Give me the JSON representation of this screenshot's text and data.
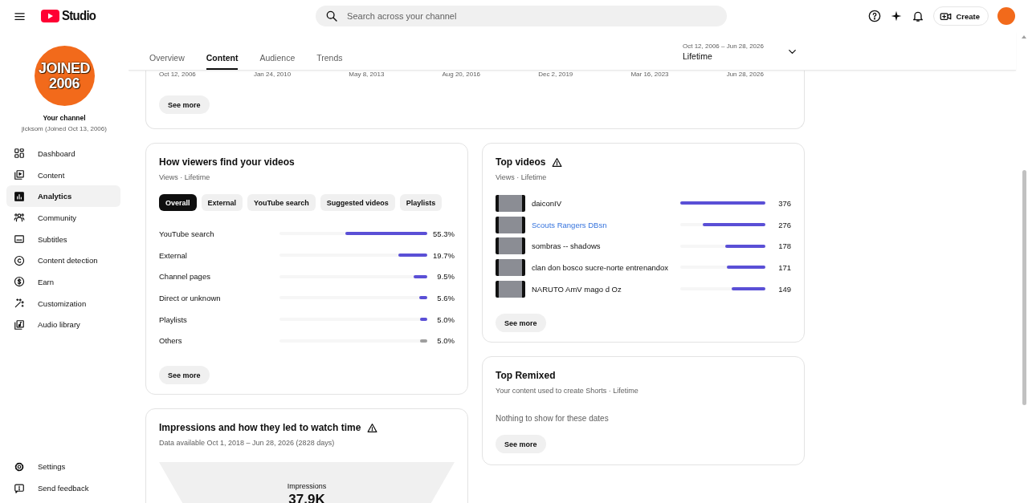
{
  "topbar": {
    "logo_text": "Studio",
    "search": {
      "placeholder": "Search across your channel"
    },
    "create_button": "Create"
  },
  "channel": {
    "avatar_text": [
      "JOINED",
      "2006"
    ],
    "title": "Your channel",
    "subtitle": "jicksom (Joined Oct 13, 2006)"
  },
  "sidebar": {
    "items": [
      {
        "label": "Dashboard",
        "selected": false
      },
      {
        "label": "Content",
        "selected": false
      },
      {
        "label": "Analytics",
        "selected": true
      },
      {
        "label": "Community",
        "selected": false
      },
      {
        "label": "Subtitles",
        "selected": false
      },
      {
        "label": "Content detection",
        "selected": false
      },
      {
        "label": "Earn",
        "selected": false
      },
      {
        "label": "Customization",
        "selected": false
      },
      {
        "label": "Audio library",
        "selected": false
      }
    ],
    "footer_items": [
      {
        "label": "Settings"
      },
      {
        "label": "Send feedback"
      }
    ]
  },
  "tabs": [
    {
      "label": "Overview",
      "selected": false
    },
    {
      "label": "Content",
      "selected": true
    },
    {
      "label": "Audience",
      "selected": false
    },
    {
      "label": "Trends",
      "selected": false
    }
  ],
  "date_range": {
    "range": "Oct 12, 2006 – Jun 28, 2026",
    "period": "Lifetime"
  },
  "overview_card": {
    "axis_labels": [
      "Oct 12, 2006",
      "Jan 24, 2010",
      "May 8, 2013",
      "Aug 20, 2016",
      "Dec 2, 2019",
      "Mar 16, 2023",
      "Jun 28, 2026"
    ],
    "see_more": "See more"
  },
  "traffic_sources": {
    "title": "How viewers find your videos",
    "subtitle": "Views · Lifetime",
    "filters": [
      {
        "label": "Overall",
        "selected": true
      },
      {
        "label": "External",
        "selected": false
      },
      {
        "label": "YouTube search",
        "selected": false
      },
      {
        "label": "Suggested videos",
        "selected": false
      },
      {
        "label": "Playlists",
        "selected": false
      }
    ],
    "rows": [
      {
        "label": "YouTube search",
        "level": 0.553,
        "reading": "55.3%",
        "color": "#5a4fd6"
      },
      {
        "label": "External",
        "level": 0.197,
        "reading": "19.7%",
        "color": "#5a4fd6"
      },
      {
        "label": "Channel pages",
        "level": 0.095,
        "reading": "9.5%",
        "color": "#5a4fd6"
      },
      {
        "label": "Direct or unknown",
        "level": 0.056,
        "reading": "5.6%",
        "color": "#5a4fd6"
      },
      {
        "label": "Playlists",
        "level": 0.05,
        "reading": "5.0%",
        "color": "#5a4fd6"
      },
      {
        "label": "Others",
        "level": 0.05,
        "reading": "5.0%",
        "color": "#9e9e9e"
      }
    ],
    "see_more": "See more"
  },
  "top_videos": {
    "title": "Top videos",
    "subtitle": "Views · Lifetime",
    "rows": [
      {
        "title": "daiconIV",
        "highlighted": false,
        "level": 1,
        "reading": "376"
      },
      {
        "title": "Scouts Rangers DBsn",
        "highlighted": true,
        "level": 0.734,
        "reading": "276"
      },
      {
        "title": "sombras -- shadows",
        "highlighted": false,
        "level": 0.473,
        "reading": "178"
      },
      {
        "title": "clan don bosco sucre-norte entrenandox",
        "highlighted": false,
        "level": 0.455,
        "reading": "171"
      },
      {
        "title": "NARUTO AmV mago d Oz",
        "highlighted": false,
        "level": 0.396,
        "reading": "149"
      }
    ],
    "see_more": "See more"
  },
  "top_remixed": {
    "title": "Top Remixed",
    "subtitle": "Your content used to create Shorts · Lifetime",
    "empty_message": "Nothing to show for these dates",
    "see_more": "See more"
  },
  "impressions": {
    "title": "Impressions and how they led to watch time",
    "subtitle": "Data available Oct 1, 2018 – Jun 28, 2026 (2828 days)",
    "funnel_label": "Impressions",
    "funnel_value": "37.9K"
  }
}
